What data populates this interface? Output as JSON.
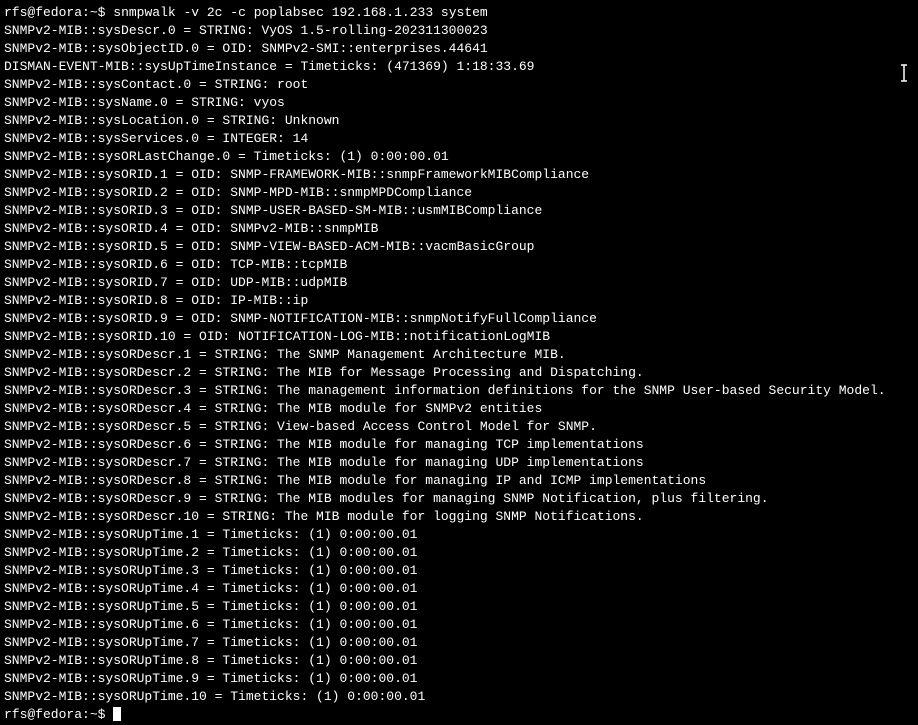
{
  "prompt": {
    "user_host": "rfs@fedora",
    "separator": ":",
    "path": "~",
    "dollar": "$"
  },
  "command": "snmpwalk -v 2c -c poplabsec 192.168.1.233 system",
  "output_lines": [
    "SNMPv2-MIB::sysDescr.0 = STRING: VyOS 1.5-rolling-202311300023",
    "SNMPv2-MIB::sysObjectID.0 = OID: SNMPv2-SMI::enterprises.44641",
    "DISMAN-EVENT-MIB::sysUpTimeInstance = Timeticks: (471369) 1:18:33.69",
    "SNMPv2-MIB::sysContact.0 = STRING: root",
    "SNMPv2-MIB::sysName.0 = STRING: vyos",
    "SNMPv2-MIB::sysLocation.0 = STRING: Unknown",
    "SNMPv2-MIB::sysServices.0 = INTEGER: 14",
    "SNMPv2-MIB::sysORLastChange.0 = Timeticks: (1) 0:00:00.01",
    "SNMPv2-MIB::sysORID.1 = OID: SNMP-FRAMEWORK-MIB::snmpFrameworkMIBCompliance",
    "SNMPv2-MIB::sysORID.2 = OID: SNMP-MPD-MIB::snmpMPDCompliance",
    "SNMPv2-MIB::sysORID.3 = OID: SNMP-USER-BASED-SM-MIB::usmMIBCompliance",
    "SNMPv2-MIB::sysORID.4 = OID: SNMPv2-MIB::snmpMIB",
    "SNMPv2-MIB::sysORID.5 = OID: SNMP-VIEW-BASED-ACM-MIB::vacmBasicGroup",
    "SNMPv2-MIB::sysORID.6 = OID: TCP-MIB::tcpMIB",
    "SNMPv2-MIB::sysORID.7 = OID: UDP-MIB::udpMIB",
    "SNMPv2-MIB::sysORID.8 = OID: IP-MIB::ip",
    "SNMPv2-MIB::sysORID.9 = OID: SNMP-NOTIFICATION-MIB::snmpNotifyFullCompliance",
    "SNMPv2-MIB::sysORID.10 = OID: NOTIFICATION-LOG-MIB::notificationLogMIB",
    "SNMPv2-MIB::sysORDescr.1 = STRING: The SNMP Management Architecture MIB.",
    "SNMPv2-MIB::sysORDescr.2 = STRING: The MIB for Message Processing and Dispatching.",
    "SNMPv2-MIB::sysORDescr.3 = STRING: The management information definitions for the SNMP User-based Security Model.",
    "SNMPv2-MIB::sysORDescr.4 = STRING: The MIB module for SNMPv2 entities",
    "SNMPv2-MIB::sysORDescr.5 = STRING: View-based Access Control Model for SNMP.",
    "SNMPv2-MIB::sysORDescr.6 = STRING: The MIB module for managing TCP implementations",
    "SNMPv2-MIB::sysORDescr.7 = STRING: The MIB module for managing UDP implementations",
    "SNMPv2-MIB::sysORDescr.8 = STRING: The MIB module for managing IP and ICMP implementations",
    "SNMPv2-MIB::sysORDescr.9 = STRING: The MIB modules for managing SNMP Notification, plus filtering.",
    "SNMPv2-MIB::sysORDescr.10 = STRING: The MIB module for logging SNMP Notifications.",
    "SNMPv2-MIB::sysORUpTime.1 = Timeticks: (1) 0:00:00.01",
    "SNMPv2-MIB::sysORUpTime.2 = Timeticks: (1) 0:00:00.01",
    "SNMPv2-MIB::sysORUpTime.3 = Timeticks: (1) 0:00:00.01",
    "SNMPv2-MIB::sysORUpTime.4 = Timeticks: (1) 0:00:00.01",
    "SNMPv2-MIB::sysORUpTime.5 = Timeticks: (1) 0:00:00.01",
    "SNMPv2-MIB::sysORUpTime.6 = Timeticks: (1) 0:00:00.01",
    "SNMPv2-MIB::sysORUpTime.7 = Timeticks: (1) 0:00:00.01",
    "SNMPv2-MIB::sysORUpTime.8 = Timeticks: (1) 0:00:00.01",
    "SNMPv2-MIB::sysORUpTime.9 = Timeticks: (1) 0:00:00.01",
    "SNMPv2-MIB::sysORUpTime.10 = Timeticks: (1) 0:00:00.01"
  ]
}
